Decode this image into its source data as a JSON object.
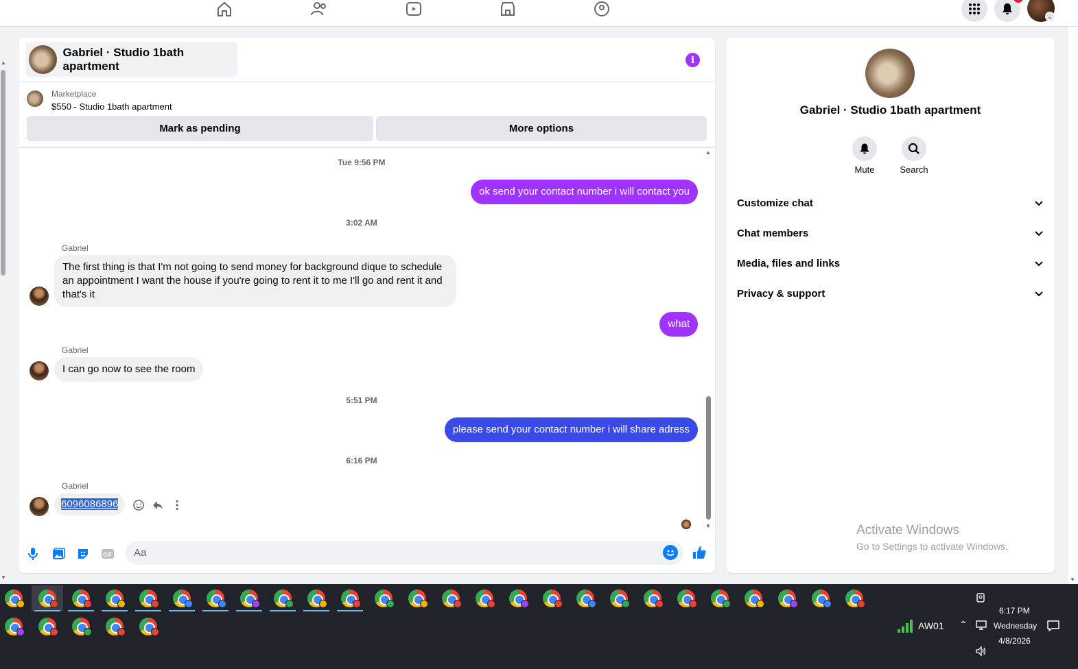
{
  "topnav": {
    "icons": [
      "home-icon",
      "friends-icon",
      "video-icon",
      "marketplace-icon",
      "groups-icon"
    ],
    "right": [
      "menu-grid-icon",
      "notifications-icon",
      "profile-avatar"
    ]
  },
  "chat": {
    "title": "Gabriel · Studio 1bath apartment",
    "marketplace": {
      "label": "Marketplace",
      "listing": "$550 - Studio 1bath apartment",
      "mark_pending": "Mark as pending",
      "more_options": "More options"
    },
    "messages": {
      "ts1": "Tue 9:56 PM",
      "out1": "ok send your contact number i will contact you",
      "ts2": "3:02 AM",
      "sender": "Gabriel",
      "in1": "The first thing is that I'm not going to send money for background dique to schedule an appointment I want the house if you're going to rent it to me I'll go and rent it and that's it",
      "out2": "what",
      "in2": "I can go now to see the room",
      "ts3": "5:51 PM",
      "out3": "please send your contact number i will share adress",
      "ts4": "6:16 PM",
      "in3": "6096086896"
    },
    "composer": {
      "placeholder": "Aa"
    }
  },
  "side": {
    "name": "Gabriel · Studio 1bath apartment",
    "mute": "Mute",
    "search": "Search",
    "sections": [
      "Customize chat",
      "Chat members",
      "Media, files and links",
      "Privacy & support"
    ],
    "watermark_title": "Activate Windows",
    "watermark_sub": "Go to Settings to activate Windows."
  },
  "taskbar": {
    "network": "AW01",
    "time": "6:17 PM",
    "day": "Wednesday",
    "date": "4/8/2026"
  },
  "colors": {
    "outgoing_bubble": "#a033ff",
    "outgoing_bubble_blue": "#3a4ae8",
    "taskbar": "#20242a"
  }
}
